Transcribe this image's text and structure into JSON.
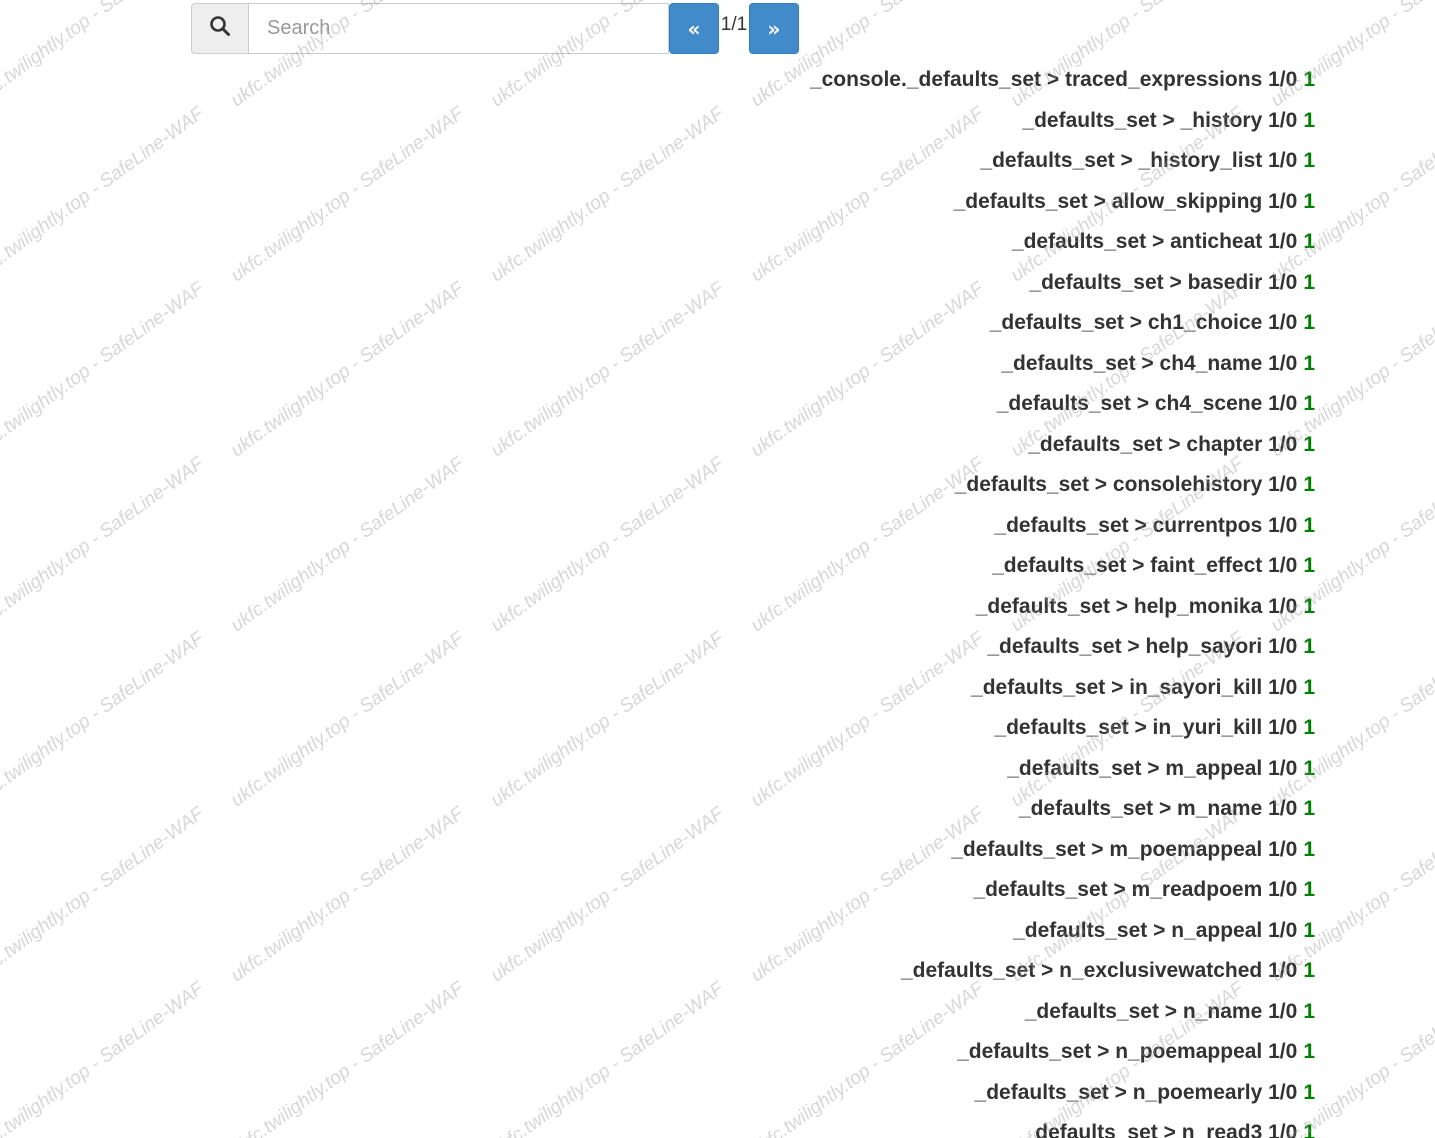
{
  "search": {
    "placeholder": "Search",
    "icon": "search-icon"
  },
  "pagination": {
    "prev_label": "«",
    "next_label": "»",
    "page_text": "1/1"
  },
  "watermark_text": "ukfc.twilightly.top - SafeLine-WAF",
  "colors": {
    "accent": "#428bca",
    "value_green": "#008000",
    "text": "#333333"
  },
  "items": [
    {
      "path": "_console._defaults_set > traced_expressions",
      "count": "1/0",
      "value": "1"
    },
    {
      "path": "_defaults_set > _history",
      "count": "1/0",
      "value": "1"
    },
    {
      "path": "_defaults_set > _history_list",
      "count": "1/0",
      "value": "1"
    },
    {
      "path": "_defaults_set > allow_skipping",
      "count": "1/0",
      "value": "1"
    },
    {
      "path": "_defaults_set > anticheat",
      "count": "1/0",
      "value": "1"
    },
    {
      "path": "_defaults_set > basedir",
      "count": "1/0",
      "value": "1"
    },
    {
      "path": "_defaults_set > ch1_choice",
      "count": "1/0",
      "value": "1"
    },
    {
      "path": "_defaults_set > ch4_name",
      "count": "1/0",
      "value": "1"
    },
    {
      "path": "_defaults_set > ch4_scene",
      "count": "1/0",
      "value": "1"
    },
    {
      "path": "_defaults_set > chapter",
      "count": "1/0",
      "value": "1"
    },
    {
      "path": "_defaults_set > consolehistory",
      "count": "1/0",
      "value": "1"
    },
    {
      "path": "_defaults_set > currentpos",
      "count": "1/0",
      "value": "1"
    },
    {
      "path": "_defaults_set > faint_effect",
      "count": "1/0",
      "value": "1"
    },
    {
      "path": "_defaults_set > help_monika",
      "count": "1/0",
      "value": "1"
    },
    {
      "path": "_defaults_set > help_sayori",
      "count": "1/0",
      "value": "1"
    },
    {
      "path": "_defaults_set > in_sayori_kill",
      "count": "1/0",
      "value": "1"
    },
    {
      "path": "_defaults_set > in_yuri_kill",
      "count": "1/0",
      "value": "1"
    },
    {
      "path": "_defaults_set > m_appeal",
      "count": "1/0",
      "value": "1"
    },
    {
      "path": "_defaults_set > m_name",
      "count": "1/0",
      "value": "1"
    },
    {
      "path": "_defaults_set > m_poemappeal",
      "count": "1/0",
      "value": "1"
    },
    {
      "path": "_defaults_set > m_readpoem",
      "count": "1/0",
      "value": "1"
    },
    {
      "path": "_defaults_set > n_appeal",
      "count": "1/0",
      "value": "1"
    },
    {
      "path": "_defaults_set > n_exclusivewatched",
      "count": "1/0",
      "value": "1"
    },
    {
      "path": "_defaults_set > n_name",
      "count": "1/0",
      "value": "1"
    },
    {
      "path": "_defaults_set > n_poemappeal",
      "count": "1/0",
      "value": "1"
    },
    {
      "path": "_defaults_set > n_poemearly",
      "count": "1/0",
      "value": "1"
    },
    {
      "path": "_defaults_set > n_read3",
      "count": "1/0",
      "value": "1"
    }
  ]
}
